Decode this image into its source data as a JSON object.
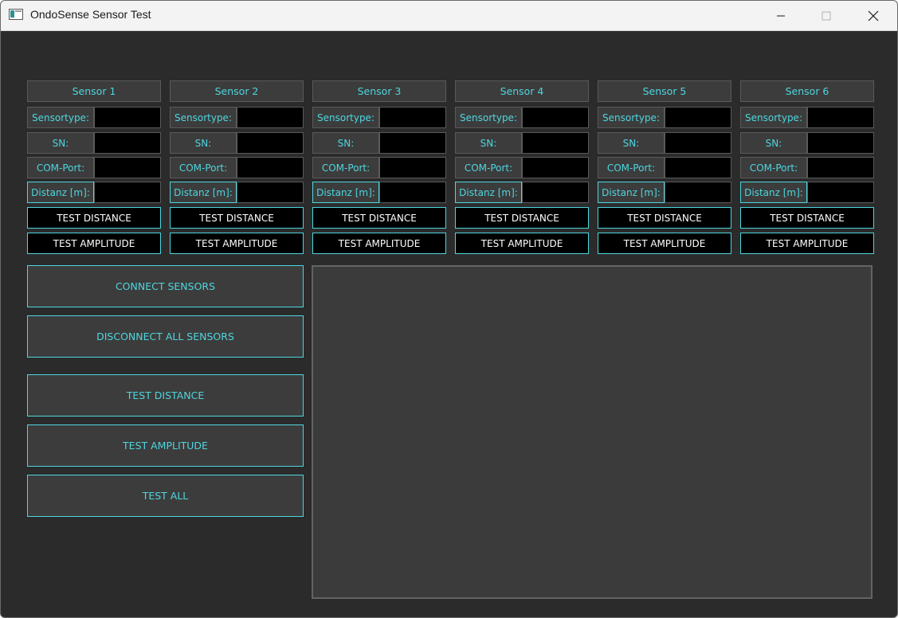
{
  "window": {
    "title": "OndoSense Sensor Test"
  },
  "sensors": [
    {
      "header": "Sensor 1",
      "sensortype_label": "Sensortype:",
      "sn_label": "SN:",
      "com_label": "COM-Port:",
      "distance_label": "Distanz [m]:",
      "sensortype": "",
      "sn": "",
      "com": "",
      "distance": "",
      "test_distance_label": "TEST DISTANCE",
      "test_amplitude_label": "TEST AMPLITUDE"
    },
    {
      "header": "Sensor 2",
      "sensortype_label": "Sensortype:",
      "sn_label": "SN:",
      "com_label": "COM-Port:",
      "distance_label": "Distanz [m]:",
      "sensortype": "",
      "sn": "",
      "com": "",
      "distance": "",
      "test_distance_label": "TEST DISTANCE",
      "test_amplitude_label": "TEST AMPLITUDE"
    },
    {
      "header": "Sensor 3",
      "sensortype_label": "Sensortype:",
      "sn_label": "SN:",
      "com_label": "COM-Port:",
      "distance_label": "Distanz [m]:",
      "sensortype": "",
      "sn": "",
      "com": "",
      "distance": "",
      "test_distance_label": "TEST DISTANCE",
      "test_amplitude_label": "TEST AMPLITUDE"
    },
    {
      "header": "Sensor 4",
      "sensortype_label": "Sensortype:",
      "sn_label": "SN:",
      "com_label": "COM-Port:",
      "distance_label": "Distanz [m]:",
      "sensortype": "",
      "sn": "",
      "com": "",
      "distance": "",
      "test_distance_label": "TEST DISTANCE",
      "test_amplitude_label": "TEST AMPLITUDE"
    },
    {
      "header": "Sensor 5",
      "sensortype_label": "Sensortype:",
      "sn_label": "SN:",
      "com_label": "COM-Port:",
      "distance_label": "Distanz [m]:",
      "sensortype": "",
      "sn": "",
      "com": "",
      "distance": "",
      "test_distance_label": "TEST DISTANCE",
      "test_amplitude_label": "TEST AMPLITUDE"
    },
    {
      "header": "Sensor 6",
      "sensortype_label": "Sensortype:",
      "sn_label": "SN:",
      "com_label": "COM-Port:",
      "distance_label": "Distanz [m]:",
      "sensortype": "",
      "sn": "",
      "com": "",
      "distance": "",
      "test_distance_label": "TEST DISTANCE",
      "test_amplitude_label": "TEST AMPLITUDE"
    }
  ],
  "controls": {
    "connect_label": "CONNECT SENSORS",
    "disconnect_label": "DISCONNECT ALL SENSORS",
    "test_distance_label": "TEST DISTANCE",
    "test_amplitude_label": "TEST AMPLITUDE",
    "test_all_label": "TEST ALL"
  },
  "output": {
    "text": ""
  },
  "colors": {
    "accent": "#4ed6df",
    "background": "#2b2b2b",
    "panel": "#3c3c3c",
    "field": "#000000"
  },
  "icons": {
    "app": "app-window-icon",
    "minimize": "minimize-icon",
    "maximize": "maximize-icon",
    "close": "close-icon"
  }
}
